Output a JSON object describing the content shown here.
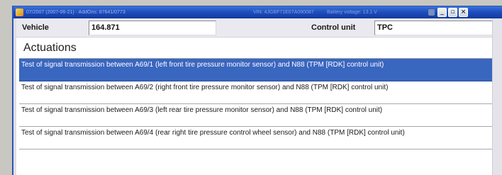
{
  "window": {
    "title_left": "07/2007 (2007-06-21) · AddOns: 87641/0773",
    "title_vin": "VIN: 4JGBF71E07A090087",
    "title_battery": "Battery voltage: 13.1 V",
    "controls": {
      "minimize": "_",
      "maximize": "▫",
      "close": "×"
    }
  },
  "header": {
    "vehicle_label": "Vehicle",
    "vehicle_value": "164.871",
    "control_unit_label": "Control unit",
    "control_unit_value": "TPC"
  },
  "section": {
    "title": "Actuations"
  },
  "actuations": [
    {
      "label": "Test of signal transmission between A69/1 (left front tire pressure monitor sensor) and N88 (TPM [RDK] control unit)",
      "selected": true
    },
    {
      "label": "Test of signal transmission between A69/2 (right front tire pressure monitor sensor) and N88 (TPM [RDK] control unit)",
      "selected": false
    },
    {
      "label": "Test of signal transmission between A69/3 (left rear tire pressure monitor sensor) and N88 (TPM [RDK] control unit)",
      "selected": false
    },
    {
      "label": "Test of signal transmission between A69/4 (rear right tire pressure control wheel sensor) and N88 (TPM [RDK] control unit)",
      "selected": false
    }
  ],
  "colors": {
    "selection": "#3966bf",
    "titlebar": "#1f4fbf"
  }
}
